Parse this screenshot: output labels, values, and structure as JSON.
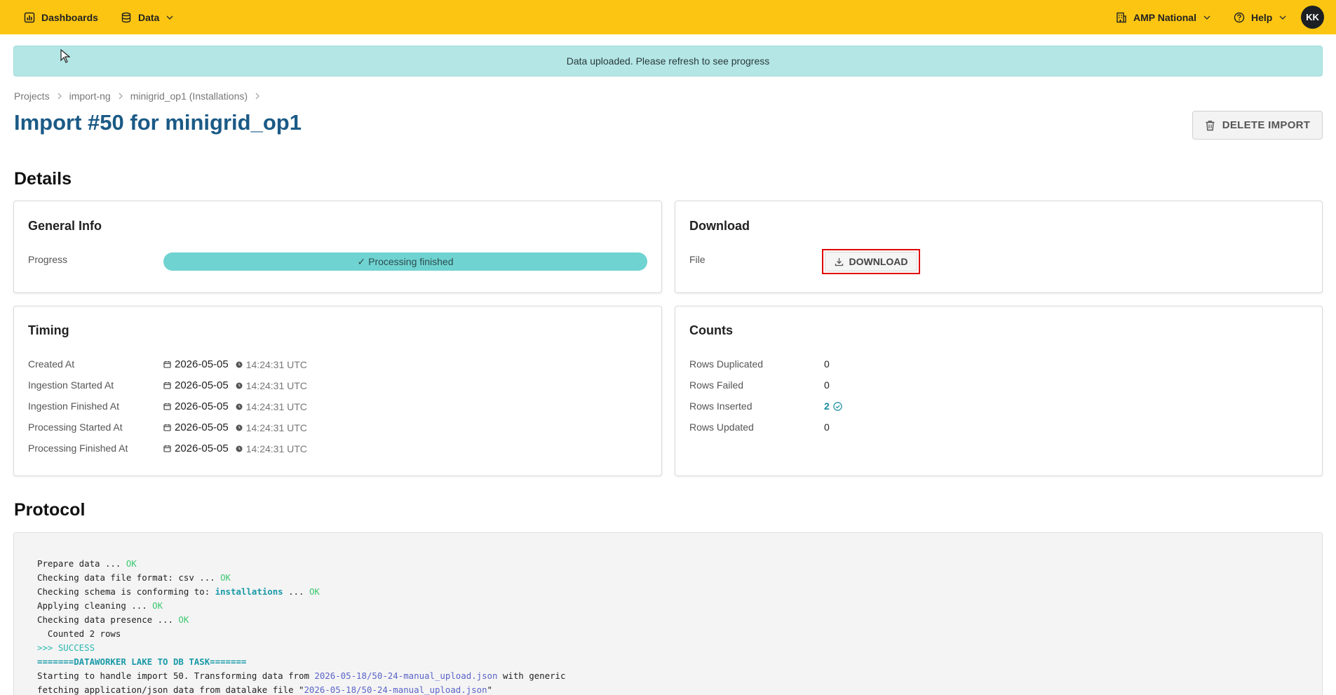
{
  "nav": {
    "dashboards": "Dashboards",
    "data": "Data",
    "org": "AMP National",
    "help": "Help",
    "avatar": "KK"
  },
  "alert": {
    "message": "Data uploaded. Please refresh to see progress"
  },
  "breadcrumb": [
    "Projects",
    "import-ng",
    "minigrid_op1 (Installations)"
  ],
  "page_title": "Import #50 for minigrid_op1",
  "delete_button": "DELETE IMPORT",
  "details_heading": "Details",
  "general_info": {
    "title": "General Info",
    "progress_label": "Progress",
    "progress_text": "✓ Processing finished",
    "progress_percent": 100
  },
  "download": {
    "title": "Download",
    "file_label": "File",
    "button": "DOWNLOAD"
  },
  "timing": {
    "title": "Timing",
    "rows": [
      {
        "label": "Created At",
        "date": "2026-05-05",
        "time": "14:24:31 UTC"
      },
      {
        "label": "Ingestion Started At",
        "date": "2026-05-05",
        "time": "14:24:31 UTC"
      },
      {
        "label": "Ingestion Finished At",
        "date": "2026-05-05",
        "time": "14:24:31 UTC"
      },
      {
        "label": "Processing Started At",
        "date": "2026-05-05",
        "time": "14:24:31 UTC"
      },
      {
        "label": "Processing Finished At",
        "date": "2026-05-05",
        "time": "14:24:31 UTC"
      }
    ]
  },
  "counts": {
    "title": "Counts",
    "rows": [
      {
        "label": "Rows Duplicated",
        "value": "0"
      },
      {
        "label": "Rows Failed",
        "value": "0"
      },
      {
        "label": "Rows Inserted",
        "value": "2"
      },
      {
        "label": "Rows Updated",
        "value": "0"
      }
    ]
  },
  "protocol": {
    "heading": "Protocol",
    "l1": "Prepare data ... ",
    "l1_ok": "OK",
    "l2": "Checking data file format: csv ... ",
    "l2_ok": "OK",
    "l3": "Checking schema is conforming to: ",
    "l3_hl": "installations",
    "l3_mid": " ... ",
    "l3_ok": "OK",
    "l4": "Applying cleaning ... ",
    "l4_ok": "OK",
    "l5": "Checking data presence ... ",
    "l5_ok": "OK",
    "l6": "  Counted 2 rows",
    "l7": ">>> SUCCESS",
    "l8": "=======DATAWORKER LAKE TO DB TASK=======",
    "l9a": "Starting to handle import 50. Transforming data from ",
    "l9_file": "2026-05-18/50-24-manual_upload.json",
    "l9b": " with generic",
    "l10a": "fetching application/json data from datalake file \"",
    "l10_file": "2026-05-18/50-24-manual_upload.json",
    "l10b": "\""
  },
  "colors": {
    "topbar": "#fbc512",
    "title": "#1b5a86",
    "progress": "#6fd3d1",
    "alert": "#b4e6e6",
    "ok": "#3cc870",
    "highlight_box": "#e00000"
  }
}
